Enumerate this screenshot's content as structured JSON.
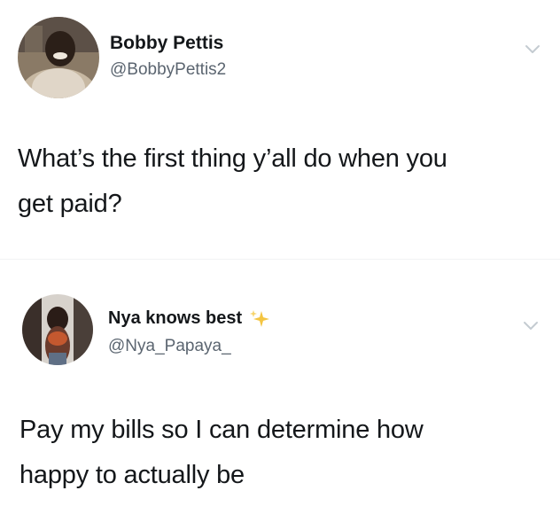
{
  "tweets": [
    {
      "user_name": "Bobby Pettis",
      "handle": "@BobbyPettis2",
      "text_lines": [
        "What’s the first thing y’all do when you",
        "get paid?"
      ],
      "avatar_icon": "user-avatar-photo",
      "menu_icon": "chevron-down-icon"
    },
    {
      "user_name": "Nya knows best",
      "name_emoji": "sparkles-emoji",
      "handle": "@Nya_Papaya_",
      "text_lines": [
        "Pay my bills so I can determine how",
        "happy to actually be"
      ],
      "avatar_icon": "user-avatar-photo",
      "menu_icon": "chevron-down-icon"
    }
  ],
  "colors": {
    "text": "#14171a",
    "handle": "#5b6570",
    "chevron": "#c4cbd1",
    "sparkle": "#f4c542"
  }
}
